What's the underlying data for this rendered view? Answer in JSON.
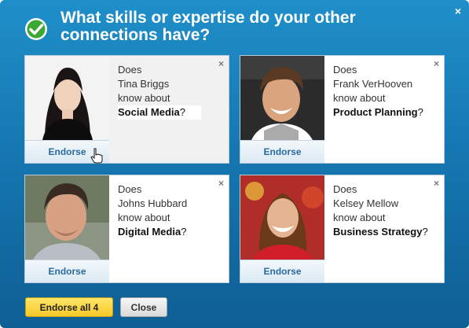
{
  "dialog": {
    "title": "What skills or expertise do your other connections have?",
    "close_label": "×"
  },
  "cards": [
    {
      "line1": "Does",
      "name": "Tina Briggs",
      "line3": "know about",
      "skill": "Social Media",
      "qmark": "?",
      "endorse_label": "Endorse",
      "close_label": "×"
    },
    {
      "line1": "Does",
      "name": "Frank VerHooven",
      "line3": "know about",
      "skill": "Product Planning",
      "qmark": "?",
      "endorse_label": "Endorse",
      "close_label": "×"
    },
    {
      "line1": "Does",
      "name": "Johns Hubbard",
      "line3": "know about",
      "skill": "Digital Media",
      "qmark": "?",
      "endorse_label": "Endorse",
      "close_label": "×"
    },
    {
      "line1": "Does",
      "name": "Kelsey Mellow",
      "line3": "know about",
      "skill": "Business Strategy",
      "qmark": "?",
      "endorse_label": "Endorse",
      "close_label": "×"
    }
  ],
  "footer": {
    "endorse_all_label": "Endorse all 4",
    "close_label": "Close"
  },
  "colors": {
    "header_bg": "#1678b2",
    "primary_button": "#f7c928",
    "endorse_text": "#2a6aa0"
  },
  "icons": {
    "header": "checkmark-icon",
    "cursor": "hand-pointer-icon"
  }
}
